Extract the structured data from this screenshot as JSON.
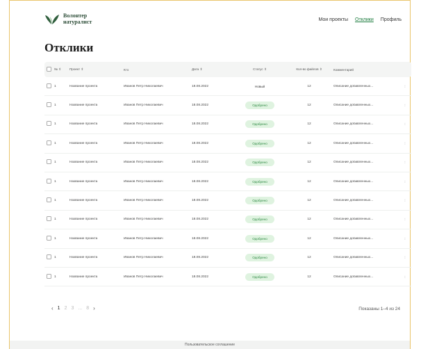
{
  "logo": {
    "line1": "Волонтер",
    "line2": "натуралист"
  },
  "nav": {
    "my_projects": "Мои проекты",
    "responses": "Отклики",
    "profile": "Профиль"
  },
  "page": {
    "title": "Отклики"
  },
  "table": {
    "headers": {
      "num": "№ ⇕",
      "project": "Проект ⇕",
      "fio": "Кто",
      "date": "Дата ⇕",
      "status": "Статус ⇕",
      "files": "Кол-во файлов ⇕",
      "comment": "Комментарий"
    },
    "rows": [
      {
        "num": "1",
        "project": "Название проекта",
        "fio": "Иванов Петр Николаевич",
        "date": "18.08.2022",
        "status": "Новый",
        "status_kind": "new",
        "files": "12",
        "comment": "Описание добавленных..."
      },
      {
        "num": "1",
        "project": "Название проекта",
        "fio": "Иванов Петр Николаевич",
        "date": "18.08.2022",
        "status": "Одобрено",
        "status_kind": "approved",
        "files": "12",
        "comment": "Описание добавленных..."
      },
      {
        "num": "1",
        "project": "Название проекта",
        "fio": "Иванов Петр Николаевич",
        "date": "18.08.2022",
        "status": "Одобрено",
        "status_kind": "approved",
        "files": "12",
        "comment": "Описание добавленных..."
      },
      {
        "num": "1",
        "project": "Название проекта",
        "fio": "Иванов Петр Николаевич",
        "date": "18.08.2022",
        "status": "Одобрено",
        "status_kind": "approved",
        "files": "12",
        "comment": "Описание добавленных..."
      },
      {
        "num": "1",
        "project": "Название проекта",
        "fio": "Иванов Петр Николаевич",
        "date": "18.08.2022",
        "status": "Одобрено",
        "status_kind": "approved",
        "files": "12",
        "comment": "Описание добавленных..."
      },
      {
        "num": "1",
        "project": "Название проекта",
        "fio": "Иванов Петр Николаевич",
        "date": "18.08.2022",
        "status": "Одобрено",
        "status_kind": "approved",
        "files": "12",
        "comment": "Описание добавленных..."
      },
      {
        "num": "1",
        "project": "Название проекта",
        "fio": "Иванов Петр Николаевич",
        "date": "18.08.2022",
        "status": "Одобрено",
        "status_kind": "approved",
        "files": "12",
        "comment": "Описание добавленных..."
      },
      {
        "num": "1",
        "project": "Название проекта",
        "fio": "Иванов Петр Николаевич",
        "date": "18.08.2022",
        "status": "Одобрено",
        "status_kind": "approved",
        "files": "12",
        "comment": "Описание добавленных..."
      },
      {
        "num": "1",
        "project": "Название проекта",
        "fio": "Иванов Петр Николаевич",
        "date": "18.08.2022",
        "status": "Одобрено",
        "status_kind": "approved",
        "files": "12",
        "comment": "Описание добавленных..."
      },
      {
        "num": "1",
        "project": "Название проекта",
        "fio": "Иванов Петр Николаевич",
        "date": "18.08.2022",
        "status": "Одобрено",
        "status_kind": "approved",
        "files": "12",
        "comment": "Описание добавленных..."
      },
      {
        "num": "1",
        "project": "Название проекта",
        "fio": "Иванов Петр Николаевич",
        "date": "18.08.2022",
        "status": "Одобрено",
        "status_kind": "approved",
        "files": "12",
        "comment": "Описание добавленных..."
      }
    ]
  },
  "pagination": {
    "prev": "‹",
    "next": "›",
    "pages": [
      "1",
      "2",
      "3",
      "...",
      "8"
    ],
    "current": "1",
    "shown": "Показаны 1–4 из 24"
  },
  "footer": {
    "agreement": "Пользовательское соглашение"
  },
  "colors": {
    "accent": "#1a7a3c",
    "approved_bg": "#dff3e0",
    "frame": "#e9c46a"
  },
  "icons": {
    "logo": "leaf-logo-icon",
    "row_menu": "kebab-menu-icon",
    "checkbox": "checkbox-icon"
  }
}
